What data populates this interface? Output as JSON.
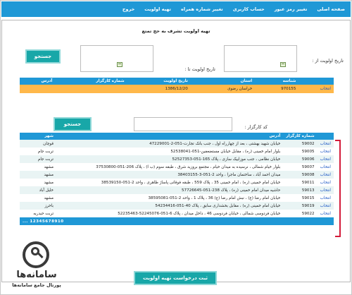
{
  "nav": {
    "items": [
      "صفحه اصلی",
      "تغییر رمز عبور",
      "حساب کاربری",
      "تغییر شماره همراه",
      "تهیه اولویت",
      "خروج"
    ]
  },
  "form": {
    "title": "تهیه اولویت تشرف به حج تمتع",
    "date_from_label": "تاریخ اولویت از :",
    "date_to_label": "تاریخ اولویت تا :",
    "search_label": "جستجو",
    "agent_code_label": "کد کارگزار :",
    "search2_label": "جستجو",
    "submit_label": "ثبت درخواست تهیه اولویت"
  },
  "table1": {
    "headers": [
      "",
      "شناسه",
      "استان",
      "تاریخ اولویت",
      "شماره کارگزار",
      "آدرس"
    ],
    "row": [
      "انتخاب",
      "970155",
      "خراسان رضوی",
      "1386/12/20",
      "",
      ""
    ]
  },
  "table2": {
    "headers": [
      "",
      "شماره کارگزار",
      "آدرس",
      "شهر"
    ],
    "rows": [
      [
        "انتخاب",
        "59002",
        "خیابان شهید بهشتی ، بعد از چهارراه اول ، جنب بانک تجارت-051-2-47229001",
        "قوچان"
      ],
      [
        "انتخاب",
        "59005",
        "بلوار امام خمینی (ره) ، مقابل خیابان مستضعفین-051-52538041",
        "تربت جام"
      ],
      [
        "انتخاب",
        "59006",
        "خیابان نظامی ، جنب موزاییک سازی ، پلاک 165-051-52527353",
        "تربت جام"
      ],
      [
        "انتخاب",
        "59007",
        "بلوار خیام شمالی ، نرسیده به میدان خیام ، مجتمع بروزید شرق ، طبقه سوم (ب ا) ، پلاک 206-051-37530800",
        "مشهد"
      ],
      [
        "انتخاب",
        "59008",
        "میدان احمد آباد ، ساختمان ماجرا ، واحد 2-051-3-38403155",
        "مشهد"
      ],
      [
        "انتخاب",
        "59011",
        "خیابان امام خمینی (ره) ، امام خمینی 35 ، پلاک 559 ، طبقه فوقانی پاساژ ظاهری ، واحد 2-051-38539150",
        "مشهد"
      ],
      [
        "انتخاب",
        "59013",
        "حاشیه میدان امام خمینی (ره) ، پلاک 238-051-57726645",
        "خلیل آباد"
      ],
      [
        "انتخاب",
        "59015",
        "خیابان امام رضا (ع) ، نبش امام رضا (ع) 36 ، پلاک 1 ، واحد 2-051-38595081",
        "مشهد"
      ],
      [
        "انتخاب",
        "59019",
        "خیابان امام خمینی (ره) ، مقابل بخشداری سابق ، پلاک 40-051-54234416",
        "باخرز"
      ],
      [
        "انتخاب",
        "59022",
        "خیابان فردوسی شمالی ، خیابان فردوسی 46 ، داخل میدان ، پلاک 6-051-52245076-52235463",
        "تربت حیدریه"
      ]
    ],
    "pager": "12345678910 ..."
  },
  "watermark": {
    "title": "سامانه‌ها",
    "subtitle": "پورتال جامع سامانه‌ها"
  },
  "colors": {
    "nav": "#1f98d6",
    "button": "#18a7a8",
    "selected_row": "#ffb84a",
    "bracket": "#d41c3a"
  }
}
